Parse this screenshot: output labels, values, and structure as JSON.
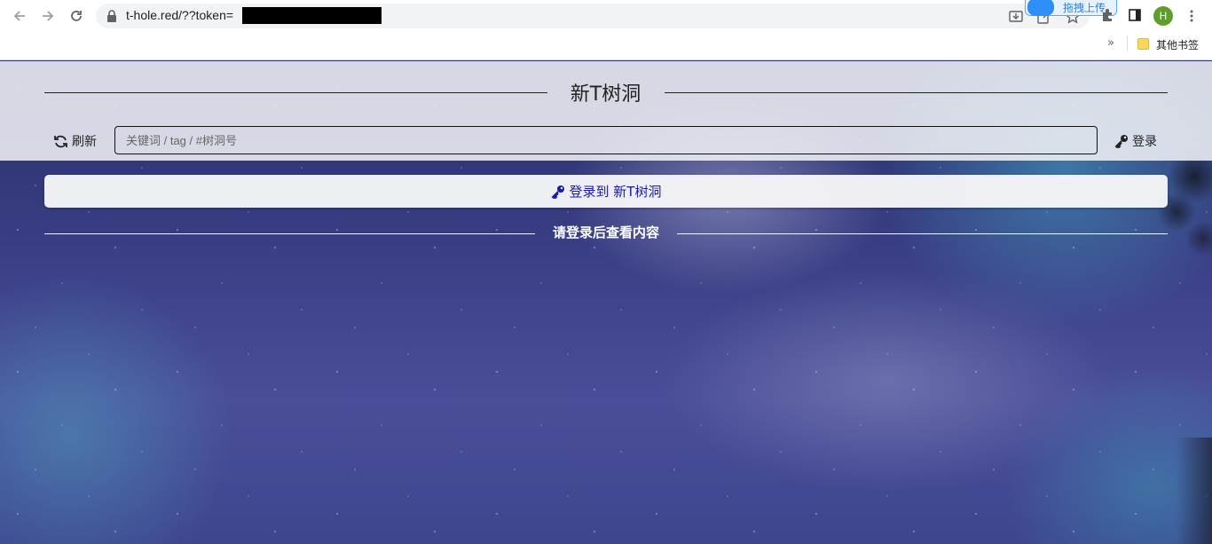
{
  "browser": {
    "url": "t-hole.red/??token=",
    "ext_badge_label": "拖拽上传",
    "avatar_letter": "H",
    "bookmarks_more": "»",
    "bookmark_folder_label": "其他书签"
  },
  "header": {
    "title": "新T树洞",
    "refresh_label": "刷新",
    "search_placeholder": "关键词 / tag / #树洞号",
    "login_label": "登录"
  },
  "main": {
    "login_card_label": "登录到 新T树洞",
    "notice": "请登录后查看内容"
  },
  "colors": {
    "link": "#1a1ab0",
    "avatar": "#5f9e2c"
  }
}
